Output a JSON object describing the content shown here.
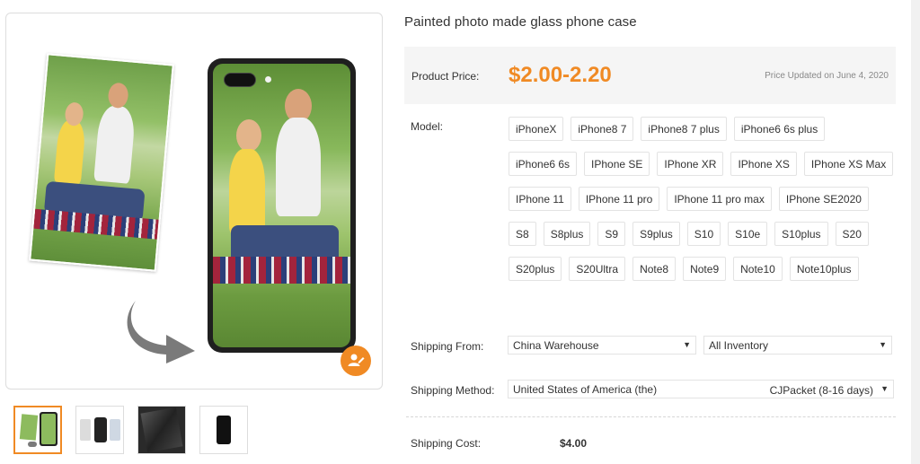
{
  "product": {
    "title": "Painted photo made glass phone case",
    "price_label": "Product Price:",
    "price_value": "$2.00-2.20",
    "price_updated": "Price Updated on June 4, 2020"
  },
  "model": {
    "label": "Model:",
    "options": [
      "iPhoneX",
      "iPhone8 7",
      "iPhone8 7 plus",
      "iPhone6 6s plus",
      "iPhone6 6s",
      "IPhone SE",
      "IPhone XR",
      "IPhone XS",
      "IPhone XS Max",
      "IPhone 11",
      "IPhone 11 pro",
      "IPhone 11 pro max",
      "IPhone SE2020",
      "S8",
      "S8plus",
      "S9",
      "S9plus",
      "S10",
      "S10e",
      "S10plus",
      "S20",
      "S20plus",
      "S20Ultra",
      "Note8",
      "Note9",
      "Note10",
      "Note10plus"
    ]
  },
  "shipping": {
    "from_label": "Shipping From:",
    "from_value": "China Warehouse",
    "inventory_value": "All Inventory",
    "method_label": "Shipping Method:",
    "method_country": "United States of America (the)",
    "method_carrier": "CJPacket (8-16 days)",
    "cost_label": "Shipping Cost:",
    "cost_value": "$4.00"
  },
  "gallery": {
    "thumbnails": [
      "thumb-photo-to-case",
      "thumb-case-variants",
      "thumb-glass-detail",
      "thumb-black-case"
    ],
    "active_index": 0
  },
  "colors": {
    "accent": "#f08a24",
    "price_bg": "#f5f5f5"
  }
}
